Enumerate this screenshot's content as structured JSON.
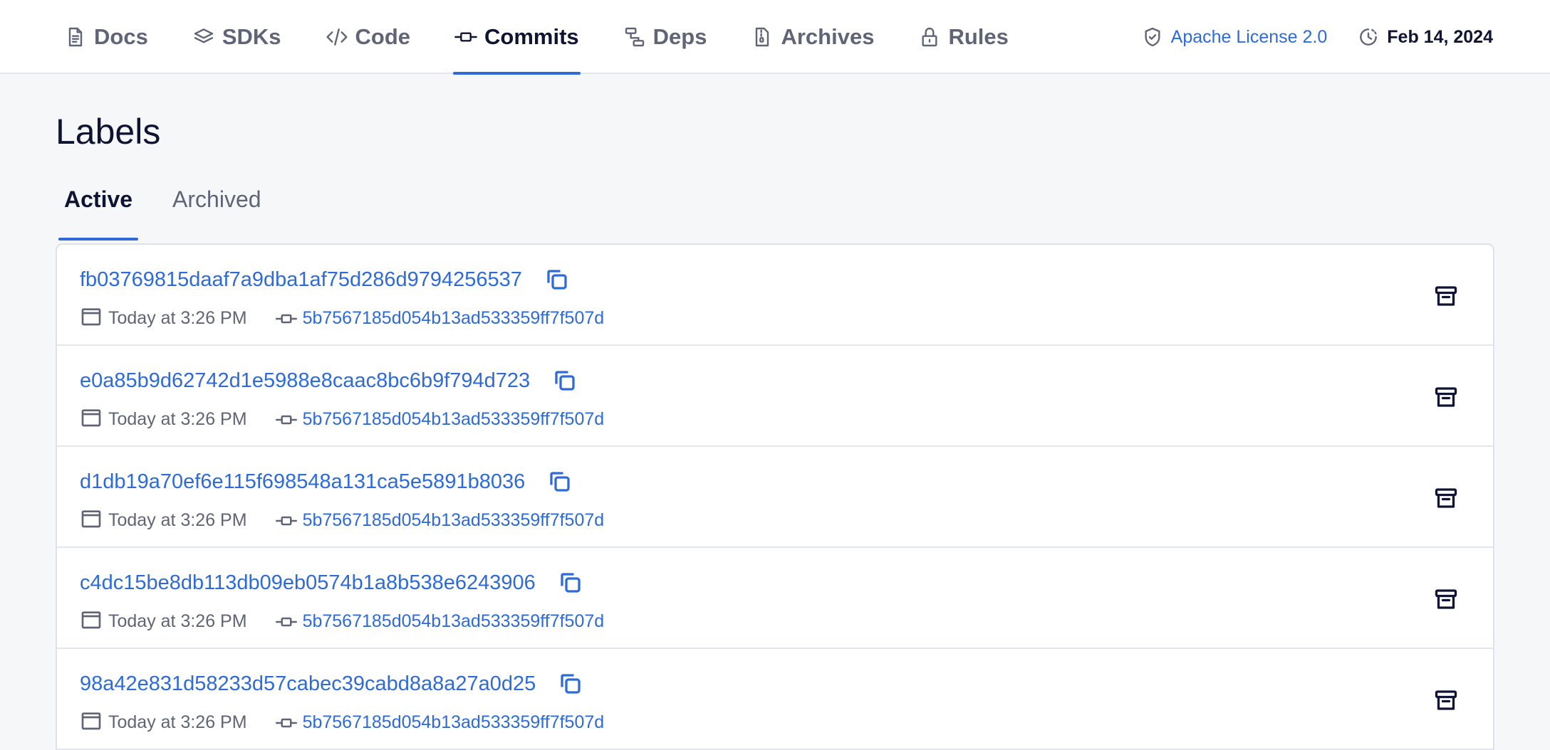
{
  "nav": {
    "tabs": [
      {
        "label": "Docs",
        "icon": "document-icon"
      },
      {
        "label": "SDKs",
        "icon": "layers-icon"
      },
      {
        "label": "Code",
        "icon": "code-icon"
      },
      {
        "label": "Commits",
        "icon": "commit-icon",
        "active": true
      },
      {
        "label": "Deps",
        "icon": "dependency-icon"
      },
      {
        "label": "Archives",
        "icon": "zip-file-icon"
      },
      {
        "label": "Rules",
        "icon": "lock-icon"
      }
    ],
    "license": {
      "label": "Apache License 2.0",
      "icon": "shield-check-icon"
    },
    "date": {
      "label": "Feb 14, 2024",
      "icon": "history-clock-icon"
    }
  },
  "page": {
    "title": "Labels",
    "tabs": [
      {
        "label": "Active",
        "active": true
      },
      {
        "label": "Archived"
      }
    ]
  },
  "labels": [
    {
      "hash": "fb03769815daaf7a9dba1af75d286d9794256537",
      "timestamp": "Today at 3:26 PM",
      "commit": "5b7567185d054b13ad533359ff7f507d"
    },
    {
      "hash": "e0a85b9d62742d1e5988e8caac8bc6b9f794d723",
      "timestamp": "Today at 3:26 PM",
      "commit": "5b7567185d054b13ad533359ff7f507d"
    },
    {
      "hash": "d1db19a70ef6e115f698548a131ca5e5891b8036",
      "timestamp": "Today at 3:26 PM",
      "commit": "5b7567185d054b13ad533359ff7f507d"
    },
    {
      "hash": "c4dc15be8db113db09eb0574b1a8b538e6243906",
      "timestamp": "Today at 3:26 PM",
      "commit": "5b7567185d054b13ad533359ff7f507d"
    },
    {
      "hash": "98a42e831d58233d57cabec39cabd8a8a27a0d25",
      "timestamp": "Today at 3:26 PM",
      "commit": "5b7567185d054b13ad533359ff7f507d"
    }
  ],
  "colors": {
    "accent": "#2e6bd9",
    "text": "#0f1433",
    "muted": "#5f6577",
    "background": "#f6f7f9"
  }
}
